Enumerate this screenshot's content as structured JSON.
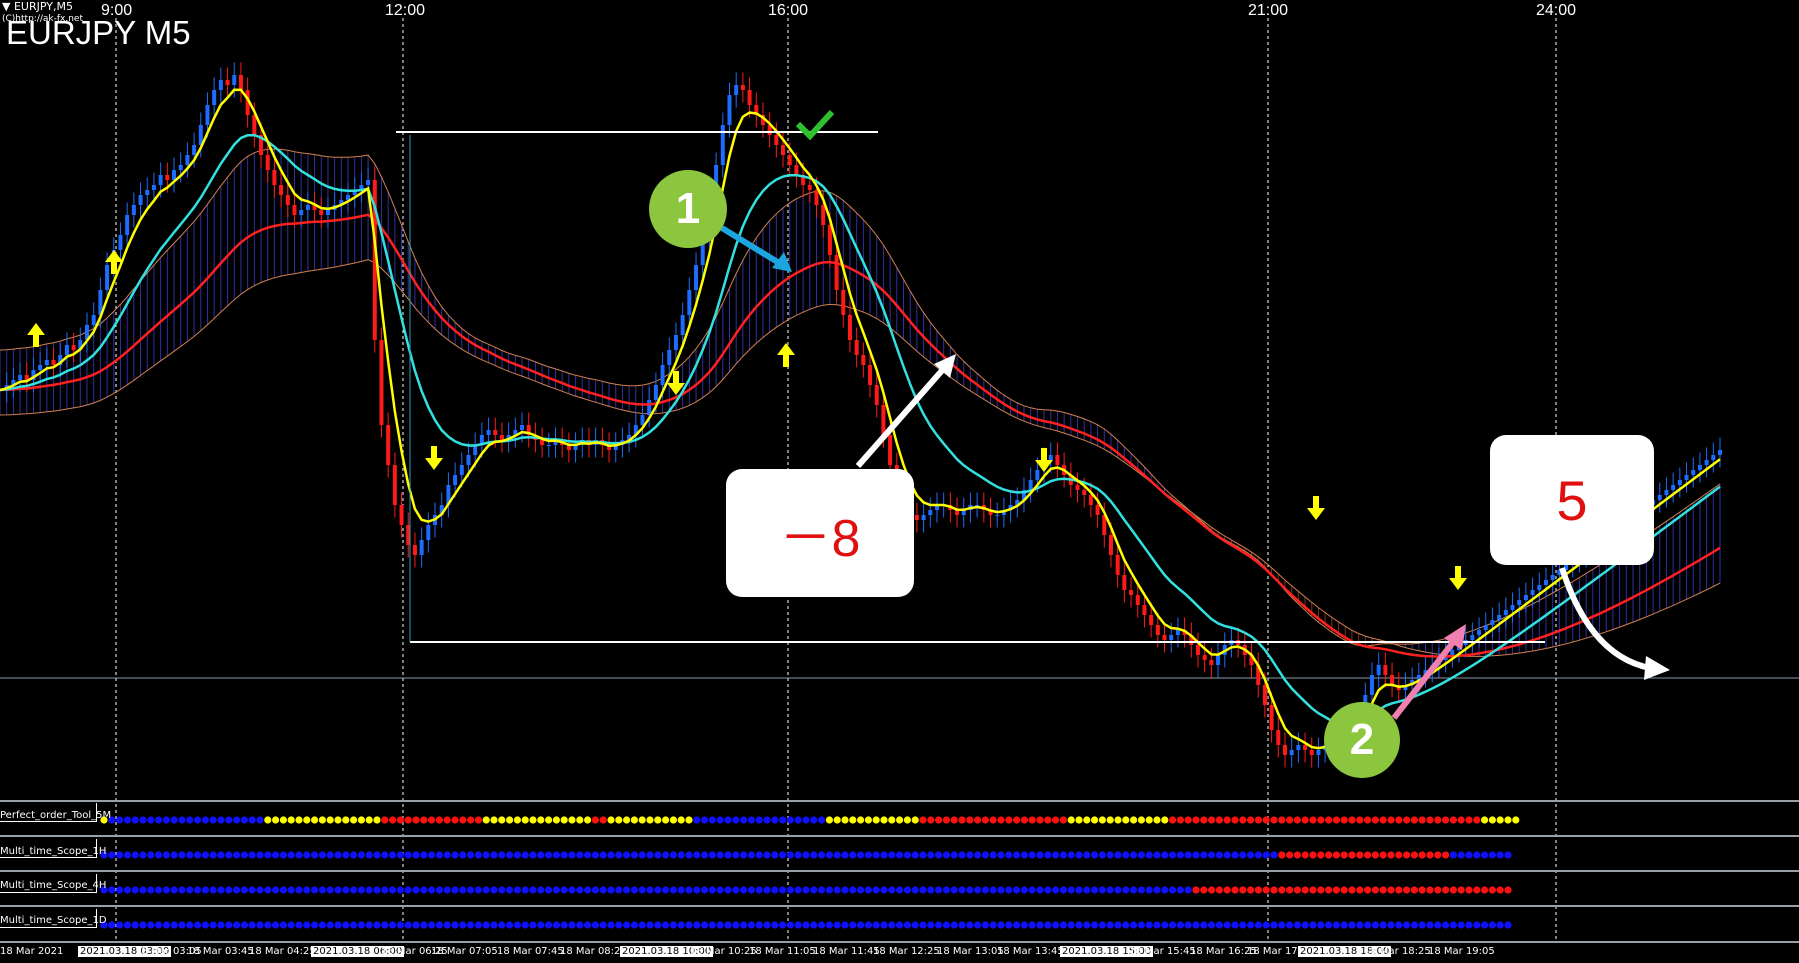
{
  "window": {
    "symbol_tab": "EURJPY,M5",
    "copyright": "(C)http://ak-fx.net",
    "title": "EURJPY M5"
  },
  "time_axis_top": [
    "9:00",
    "12:00",
    "16:00",
    "21:00",
    "24:00"
  ],
  "annotations": {
    "circle1": "1",
    "circle2": "2",
    "box_minus8": "－8",
    "box_5": "5"
  },
  "indicators": [
    {
      "name": "Perfect_order_Tool_5M"
    },
    {
      "name": "Multi_time_Scope_1H"
    },
    {
      "name": "Multi_time_Scope_4H"
    },
    {
      "name": "Multi_time_Scope_1D"
    }
  ],
  "bottom_axis": [
    {
      "t": "18 Mar 2021",
      "hl": false
    },
    {
      "t": "2021.03.18 03:00",
      "hl": true
    },
    {
      "t": "18 Mar 03:05",
      "hl": false
    },
    {
      "t": "18 Mar 03:45",
      "hl": false
    },
    {
      "t": "18 Mar 04:25",
      "hl": false
    },
    {
      "t": "2021.03.18 06:00",
      "hl": true
    },
    {
      "t": "18 Mar 06:25",
      "hl": false
    },
    {
      "t": "18 Mar 07:05",
      "hl": false
    },
    {
      "t": "18 Mar 07:45",
      "hl": false
    },
    {
      "t": "18 Mar 08:25",
      "hl": false
    },
    {
      "t": "2021.03.18 10:00",
      "hl": true
    },
    {
      "t": "18 Mar 10:25",
      "hl": false
    },
    {
      "t": "18 Mar 11:05",
      "hl": false
    },
    {
      "t": "18 Mar 11:45",
      "hl": false
    },
    {
      "t": "18 Mar 12:25",
      "hl": false
    },
    {
      "t": "18 Mar 13:05",
      "hl": false
    },
    {
      "t": "18 Mar 13:45",
      "hl": false
    },
    {
      "t": "2021.03.18 15:00",
      "hl": true
    },
    {
      "t": "18 Mar 15:45",
      "hl": false
    },
    {
      "t": "18 Mar 16:25",
      "hl": false
    },
    {
      "t": "18 Mar 17:05",
      "hl": false
    },
    {
      "t": "2021.03.18 18:00",
      "hl": true
    },
    {
      "t": "18 Mar 18:25",
      "hl": false
    },
    {
      "t": "18 Mar 19:05",
      "hl": false
    }
  ],
  "colors": {
    "background": "#000000",
    "bull_candle": "#1e6bff",
    "bear_candle": "#ff1a1a",
    "ma_fast": "#ffff00",
    "ma_mid": "#33e0e0",
    "ma_slow": "#ff2020",
    "cloud_blue": "#3030a0",
    "cloud_orange": "#d08050",
    "dot_blue": "#1010ff",
    "dot_yellow": "#ffff00",
    "dot_red": "#ff1010",
    "circle_green": "#8cc63f",
    "arrow_blue": "#1ca6e0",
    "arrow_pink": "#f080b0"
  },
  "chart_data": {
    "type": "line",
    "symbol": "EURJPY",
    "timeframe": "M5",
    "x": [
      0,
      1,
      2,
      3,
      4,
      5,
      6,
      7,
      8,
      9,
      10,
      11,
      12,
      13,
      14,
      15,
      16,
      17,
      18,
      19,
      20,
      21,
      22,
      23,
      24,
      25,
      26,
      27,
      28,
      29,
      30,
      31,
      32,
      33,
      34,
      35,
      36,
      37,
      38,
      39,
      40,
      41,
      42,
      43,
      44,
      45,
      46,
      47,
      48,
      49,
      50,
      51,
      52,
      53,
      54,
      55,
      56,
      57,
      58,
      59,
      60,
      61,
      62,
      63,
      64,
      65,
      66,
      67,
      68,
      69,
      70,
      71,
      72,
      73,
      74,
      75,
      76,
      77,
      78,
      79,
      80,
      81,
      82,
      83,
      84,
      85,
      86,
      87,
      88,
      89,
      90,
      91,
      92,
      93,
      94,
      95,
      96,
      97,
      98,
      99,
      100,
      101,
      102,
      103,
      104,
      105,
      106,
      107,
      108,
      109,
      110,
      111,
      112,
      113,
      114,
      115,
      116,
      117,
      118,
      119,
      120,
      121,
      122,
      123,
      124,
      125,
      126,
      127,
      128,
      129,
      130,
      131,
      132,
      133,
      134,
      135,
      136,
      137,
      138,
      139,
      140,
      141,
      142,
      143,
      144,
      145,
      146,
      147,
      148,
      149,
      150,
      151,
      152,
      153,
      154,
      155,
      156,
      157,
      158,
      159,
      160,
      161,
      162,
      163,
      164,
      165,
      166,
      167,
      168,
      169,
      170,
      171,
      172,
      173,
      174,
      175,
      176,
      177,
      178,
      179,
      180,
      181,
      182,
      183,
      184,
      185,
      186,
      187,
      188,
      189,
      190,
      191,
      192,
      193,
      194,
      195,
      196,
      197,
      198,
      199,
      200,
      201,
      202,
      203,
      204,
      205,
      206,
      207,
      208,
      209,
      210,
      211,
      212,
      213,
      214,
      215,
      216,
      217,
      218,
      219,
      220,
      221,
      222,
      223,
      224,
      225,
      226,
      227,
      228,
      229,
      230,
      231,
      232,
      233,
      234,
      235,
      236,
      237,
      238,
      239,
      240,
      241,
      242,
      243,
      244,
      245,
      246,
      247,
      248,
      249,
      250,
      251,
      252,
      253,
      254,
      255,
      256,
      257
    ],
    "close": [
      0.35,
      0.36,
      0.37,
      0.38,
      0.37,
      0.39,
      0.4,
      0.41,
      0.4,
      0.42,
      0.44,
      0.43,
      0.45,
      0.48,
      0.5,
      0.55,
      0.6,
      0.63,
      0.66,
      0.7,
      0.72,
      0.74,
      0.75,
      0.76,
      0.78,
      0.77,
      0.79,
      0.8,
      0.82,
      0.84,
      0.88,
      0.92,
      0.95,
      0.97,
      0.96,
      0.98,
      0.95,
      0.9,
      0.86,
      0.82,
      0.79,
      0.76,
      0.74,
      0.72,
      0.7,
      0.71,
      0.72,
      0.71,
      0.7,
      0.71,
      0.72,
      0.73,
      0.74,
      0.75,
      0.76,
      0.77,
      0.45,
      0.28,
      0.2,
      0.12,
      0.08,
      0.04,
      0.02,
      0.05,
      0.08,
      0.1,
      0.12,
      0.16,
      0.18,
      0.2,
      0.22,
      0.24,
      0.26,
      0.27,
      0.26,
      0.25,
      0.26,
      0.27,
      0.28,
      0.26,
      0.25,
      0.24,
      0.24,
      0.25,
      0.24,
      0.23,
      0.24,
      0.25,
      0.24,
      0.25,
      0.24,
      0.23,
      0.24,
      0.25,
      0.26,
      0.28,
      0.3,
      0.33,
      0.36,
      0.4,
      0.43,
      0.46,
      0.5,
      0.55,
      0.6,
      0.66,
      0.72,
      0.8,
      0.88,
      0.94,
      0.96,
      0.95,
      0.92,
      0.9,
      0.88,
      0.86,
      0.84,
      0.82,
      0.8,
      0.78,
      0.76,
      0.75,
      0.72,
      0.68,
      0.62,
      0.55,
      0.5,
      0.45,
      0.42,
      0.4,
      0.36,
      0.32,
      0.26,
      0.2,
      0.15,
      0.12,
      0.1,
      0.09,
      0.1,
      0.11,
      0.12,
      0.12,
      0.11,
      0.1,
      0.11,
      0.12,
      0.12,
      0.11,
      0.1,
      0.1,
      0.11,
      0.12,
      0.13,
      0.15,
      0.17,
      0.19,
      0.21,
      0.22,
      0.2,
      0.18,
      0.16,
      0.15,
      0.14,
      0.12,
      0.1,
      0.06,
      0.02,
      -0.02,
      -0.05,
      -0.06,
      -0.08,
      -0.1,
      -0.12,
      -0.14,
      -0.15,
      -0.14,
      -0.13,
      -0.14,
      -0.16,
      -0.18,
      -0.19,
      -0.2,
      -0.18,
      -0.16,
      -0.15,
      -0.16,
      -0.18,
      -0.2,
      -0.24,
      -0.28,
      -0.33,
      -0.36,
      -0.38,
      -0.37,
      -0.36,
      -0.37,
      -0.38,
      -0.37,
      -0.36,
      -0.37,
      -0.36,
      -0.35,
      -0.34,
      -0.3,
      -0.26,
      -0.22,
      -0.2,
      -0.22,
      -0.24,
      -0.25,
      -0.24,
      -0.23,
      -0.22,
      -0.21,
      -0.2,
      -0.19,
      -0.18,
      -0.17,
      -0.16,
      -0.15,
      -0.14,
      -0.13,
      -0.12,
      -0.11,
      -0.1,
      -0.09,
      -0.08,
      -0.07,
      -0.06,
      -0.05,
      -0.04,
      -0.03,
      -0.02,
      -0.01,
      0.0,
      0.01,
      0.02,
      0.03,
      0.04,
      0.05,
      0.06,
      0.07,
      0.08,
      0.09,
      0.1,
      0.11,
      0.12,
      0.13,
      0.14,
      0.15,
      0.16,
      0.17,
      0.18,
      0.19,
      0.2,
      0.21,
      0.22,
      0.23
    ]
  }
}
